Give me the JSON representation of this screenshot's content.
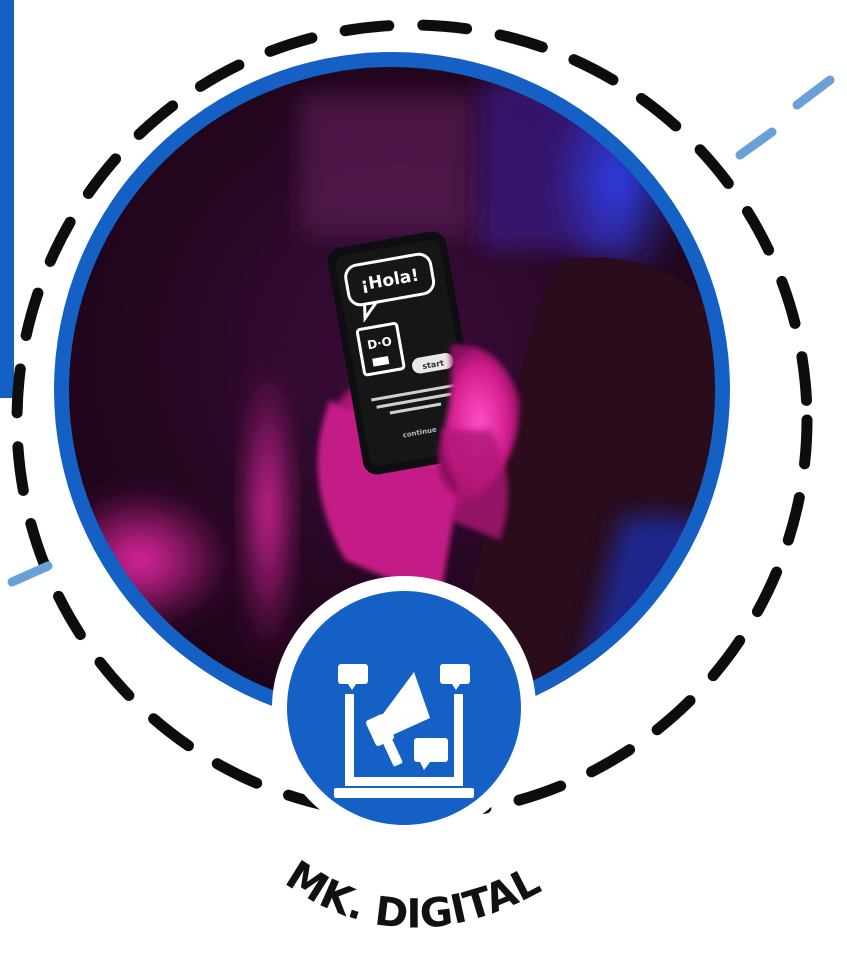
{
  "brand": {
    "label": "MK. DIGITAL"
  },
  "photo": {
    "speech_bubble_text": "¡Hola!",
    "phone_button_text": "start",
    "phone_link_text": "continue"
  },
  "colors": {
    "ring": "#1560c5",
    "dash": "#0d0d0d",
    "accent_lines": "#6a9fd8",
    "icon_circle": "#1560c5",
    "icon_fg": "#ffffff",
    "photo_magenta": "#e0149a"
  },
  "icons": {
    "badge": "laptop-megaphone-icon"
  }
}
